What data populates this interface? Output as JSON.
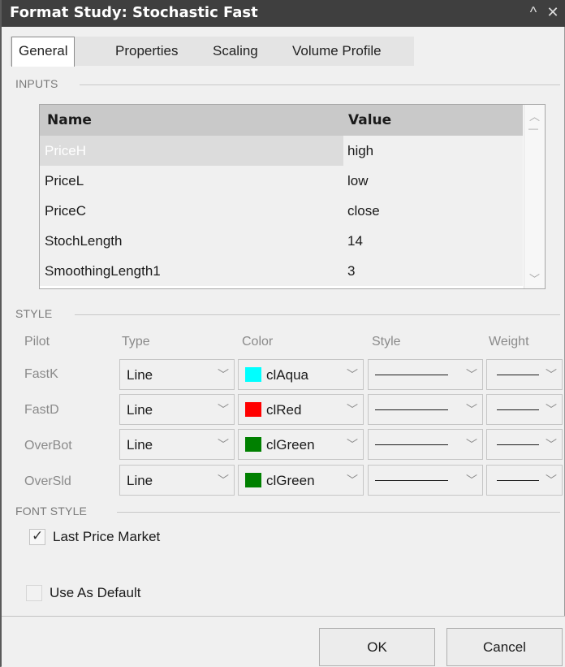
{
  "window": {
    "title": "Format Study: Stochastic Fast",
    "collapse_glyph": "^",
    "close_glyph": "✕"
  },
  "tabs": [
    {
      "label": "General",
      "active": true
    },
    {
      "label": "Properties",
      "active": false
    },
    {
      "label": "Scaling",
      "active": false
    },
    {
      "label": "Volume Profile",
      "active": false
    }
  ],
  "inputs": {
    "section_label": "INPUTS",
    "columns": {
      "name": "Name",
      "value": "Value"
    },
    "rows": [
      {
        "name": "PriceH",
        "value": "high",
        "selected": true
      },
      {
        "name": "PriceL",
        "value": "low"
      },
      {
        "name": "PriceC",
        "value": "close"
      },
      {
        "name": "StochLength",
        "value": "14"
      },
      {
        "name": "SmoothingLength1",
        "value": "3"
      }
    ]
  },
  "style": {
    "section_label": "STYLE",
    "headers": {
      "pilot": "Pilot",
      "type": "Type",
      "color": "Color",
      "style": "Style",
      "weight": "Weight"
    },
    "rows": [
      {
        "pilot": "FastK",
        "type": "Line",
        "color_name": "clAqua",
        "color_hex": "#00ffff"
      },
      {
        "pilot": "FastD",
        "type": "Line",
        "color_name": "clRed",
        "color_hex": "#ff0000"
      },
      {
        "pilot": "OverBot",
        "type": "Line",
        "color_name": "clGreen",
        "color_hex": "#008000"
      },
      {
        "pilot": "OverSld",
        "type": "Line",
        "color_name": "clGreen",
        "color_hex": "#008000"
      }
    ]
  },
  "font_style": {
    "section_label": "FONT STYLE",
    "last_price_market": {
      "label": "Last Price Market",
      "checked": true
    }
  },
  "use_as_default": {
    "label": "Use As Default",
    "checked": false
  },
  "buttons": {
    "ok": "OK",
    "cancel": "Cancel"
  },
  "icons": {
    "collapse": "caret-up-icon",
    "close": "close-icon",
    "dropdown": "chevron-down-icon",
    "check": "checkmark-icon"
  }
}
